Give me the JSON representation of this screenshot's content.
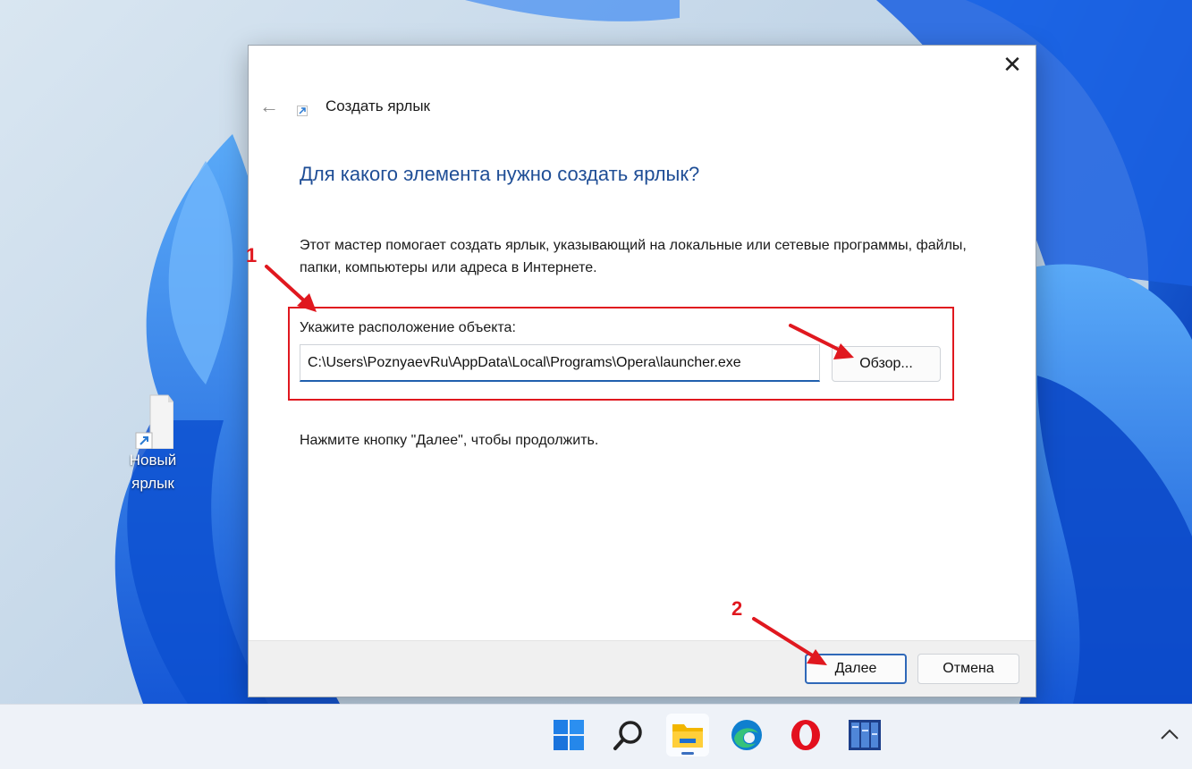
{
  "desktop": {
    "shortcut_label": "Новый ярлык"
  },
  "dialog": {
    "title": "Создать ярлык",
    "heading": "Для какого элемента нужно создать ярлык?",
    "description": "Этот мастер помогает создать ярлык, указывающий на локальные или сетевые программы, файлы, папки, компьютеры или адреса в Интернете.",
    "field_label": "Укажите расположение объекта:",
    "path_value": "C:\\Users\\PoznyaevRu\\AppData\\Local\\Programs\\Opera\\launcher.exe",
    "browse_label": "Обзор...",
    "hint": "Нажмите кнопку \"Далее\", чтобы продолжить.",
    "next_label": "Далее",
    "cancel_label": "Отмена",
    "close_glyph": "✕",
    "back_glyph": "←"
  },
  "annotations": {
    "step1": "1",
    "step2": "2",
    "color": "#e0181f"
  },
  "taskbar": {
    "items": [
      "start-icon",
      "search-icon",
      "file-explorer-icon",
      "edge-icon",
      "opera-icon",
      "app-icon"
    ],
    "active_item": "file-explorer-icon",
    "tray_glyph": "^"
  }
}
